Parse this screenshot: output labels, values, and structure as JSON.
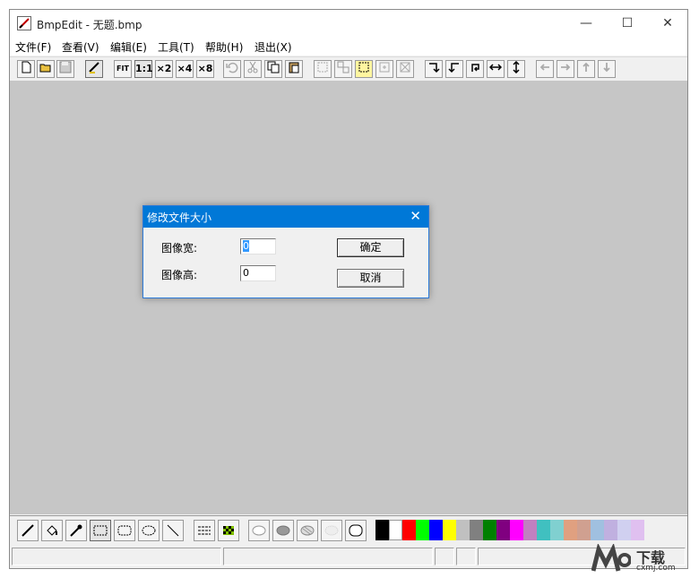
{
  "window": {
    "title": "BmpEdit - 无题.bmp",
    "minimize_glyph": "—",
    "maximize_glyph": "☐",
    "close_glyph": "✕"
  },
  "menu": [
    "文件(F)",
    "查看(V)",
    "编辑(E)",
    "工具(T)",
    "帮助(H)",
    "退出(X)"
  ],
  "toolbar": {
    "zoom_fit": "FIT",
    "zoom_1": "1:1",
    "zoom_2": "×2",
    "zoom_4": "×4",
    "zoom_8": "×8"
  },
  "dialog": {
    "title": "修改文件大小",
    "width_label": "图像宽:",
    "height_label": "图像高:",
    "width_value": "0",
    "height_value": "0",
    "ok_label": "确定",
    "cancel_label": "取消"
  },
  "palette": {
    "colors": [
      "#000000",
      "#ffffff",
      "#ff0000",
      "#00ff00",
      "#0000ff",
      "#ffff00",
      "#c0c0c0",
      "#808080",
      "#008000",
      "#800080",
      "#ff00ff",
      "#c080c0",
      "#40c0c0",
      "#80d0d0",
      "#e0a080",
      "#d0a090",
      "#a0c0e0",
      "#c0b0e0",
      "#d0d0f0",
      "#e0c0f0"
    ]
  },
  "watermark": {
    "text": "下载",
    "subtext": "cxmj.com"
  }
}
